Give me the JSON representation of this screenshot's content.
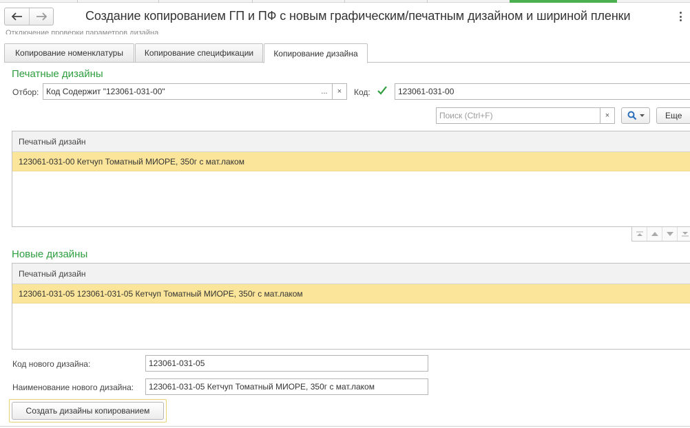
{
  "window": {
    "title": "Создание копированием ГП и ПФ с новым графическим/печатным дизайном и шириной пленки",
    "cut_link": "Отключение проверки параметров дизайна"
  },
  "tabs": [
    {
      "label": "Копирование номенклатуры",
      "active": false
    },
    {
      "label": "Копирование спецификации",
      "active": false
    },
    {
      "label": "Копирование дизайна",
      "active": true
    }
  ],
  "print_designs": {
    "title": "Печатные дизайны",
    "filter_label": "Отбор:",
    "filter_value": "Код Содержит \"123061-031-00\"",
    "filter_select": "...",
    "filter_clear": "×",
    "code_label": "Код:",
    "code_checked": true,
    "code_value": "123061-031-00",
    "search_placeholder": "Поиск (Ctrl+F)",
    "search_clear": "×",
    "more_label": "Еще",
    "table": {
      "column": "Печатный дизайн",
      "rows": [
        "123061-031-00 Кетчуп Томатный МИОРЕ, 350г с мат.лаком"
      ]
    }
  },
  "new_designs": {
    "title": "Новые дизайны",
    "table": {
      "column": "Печатный дизайн",
      "rows": [
        "123061-031-05 123061-031-05 Кетчуп Томатный МИОРЕ, 350г с мат.лаком"
      ]
    },
    "code_label": "Код нового дизайна:",
    "code_value": "123061-031-05",
    "name_label": "Наименование нового дизайна:",
    "name_value": "123061-031-05 Кетчуп Томатный МИОРЕ, 350г с мат.лаком"
  },
  "actions": {
    "create_label": "Создать дизайны копированием"
  },
  "colors": {
    "section_title": "#2e9e3e",
    "selected_row": "#fbe59a",
    "checkbox": "#2e9e3e",
    "search_icon": "#2a6ebb"
  }
}
